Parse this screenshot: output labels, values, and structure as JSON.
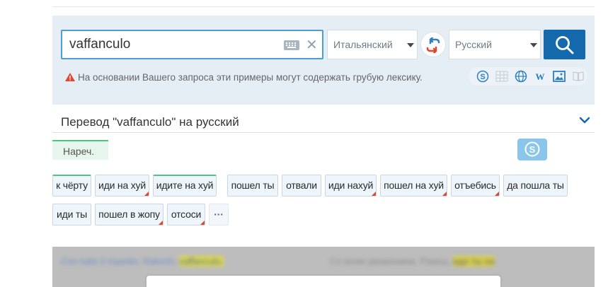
{
  "search": {
    "query": "vaffanculo",
    "source_lang": "Итальянский",
    "target_lang": "Русский",
    "warning": "На основании Вашего запроса эти примеры могут содержать грубую лексику."
  },
  "icons": {
    "keyboard": "keyboard-icon",
    "clear": "close-icon",
    "swap": "swap-languages-icon",
    "search": "search-icon",
    "warning": "warning-triangle-icon",
    "expand": "chevron-down-icon"
  },
  "toolbar": {
    "tools": [
      "skype-icon",
      "grid-icon",
      "globe-icon",
      "wikipedia-icon",
      "image-icon",
      "book-icon"
    ]
  },
  "translation": {
    "header": "Перевод \"vaffanculo\" на русский",
    "pos_badge": "Нареч.",
    "chips": [
      {
        "label": "к чёрту",
        "green": true,
        "corner": false
      },
      {
        "label": "иди на хуй",
        "green": false,
        "corner": true
      },
      {
        "label": "идите на хуй",
        "green": true,
        "corner": false
      },
      {
        "label": "пошел ты",
        "green": false,
        "corner": false
      },
      {
        "label": "отвали",
        "green": false,
        "corner": false
      },
      {
        "label": "иди нахуй",
        "green": false,
        "corner": true
      },
      {
        "label": "пошел на хуй",
        "green": false,
        "corner": true
      },
      {
        "label": "отъебись",
        "green": false,
        "corner": true
      },
      {
        "label": "да пошла ты",
        "green": false,
        "corner": false
      },
      {
        "label": "иди ты",
        "green": false,
        "corner": false
      },
      {
        "label": "пошел в жопу",
        "green": false,
        "corner": true
      },
      {
        "label": "отсоси",
        "green": false,
        "corner": true
      }
    ],
    "more_label": "···"
  },
  "example": {
    "source_text": "Con tutto il rispetto, Rakesh,",
    "source_highlight": "vaffanculo.",
    "target_text": "Со всем уважением, Ракеш,",
    "target_highlight": "иди ты на"
  },
  "colors": {
    "panel_bg": "#e5eef5",
    "accent_blue": "#1469ad",
    "input_border": "#4a9fd0",
    "green_accent": "#4fc37f",
    "warning_red": "#e0452d"
  }
}
